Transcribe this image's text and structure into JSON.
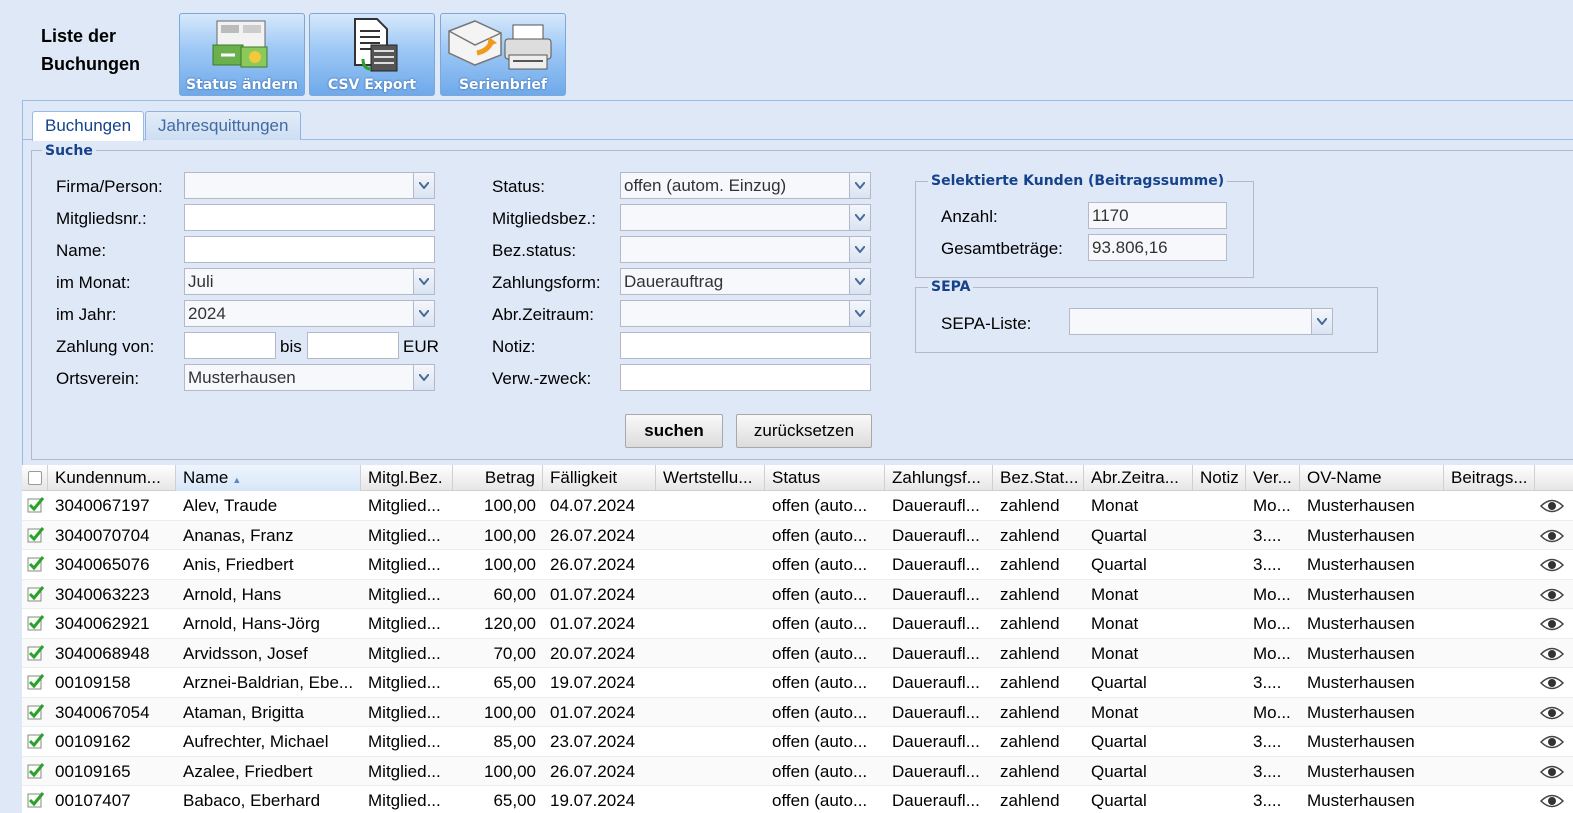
{
  "page": {
    "title": "Liste der Buchungen"
  },
  "toolbar": {
    "status_label": "Status ändern",
    "csv_label": "CSV Export",
    "serienbrief_label": "Serienbrief"
  },
  "tabs": [
    {
      "label": "Buchungen",
      "active": true
    },
    {
      "label": "Jahresquittungen",
      "active": false
    }
  ],
  "search": {
    "legend": "Suche",
    "left": {
      "firma_label": "Firma/Person:",
      "firma_value": "",
      "mitgliedsnr_label": "Mitgliedsnr.:",
      "mitgliedsnr_value": "",
      "name_label": "Name:",
      "name_value": "",
      "monat_label": "im Monat:",
      "monat_value": "Juli",
      "jahr_label": "im Jahr:",
      "jahr_value": "2024",
      "zahlung_label": "Zahlung von:",
      "zahlung_von": "",
      "bis_label": "bis",
      "zahlung_bis": "",
      "eur_label": "EUR",
      "ortsverein_label": "Ortsverein:",
      "ortsverein_value": "Musterhausen"
    },
    "middle": {
      "status_label": "Status:",
      "status_value": "offen (autom. Einzug)",
      "mitgliedsbez_label": "Mitgliedsbez.:",
      "mitgliedsbez_value": "",
      "bezstatus_label": "Bez.status:",
      "bezstatus_value": "",
      "zahlungsform_label": "Zahlungsform:",
      "zahlungsform_value": "Dauerauftrag",
      "abrzeitraum_label": "Abr.Zeitraum:",
      "abrzeitraum_value": "",
      "notiz_label": "Notiz:",
      "notiz_value": "",
      "verwzweck_label": "Verw.-zweck:",
      "verwzweck_value": ""
    },
    "selected": {
      "legend": "Selektierte Kunden (Beitragssumme)",
      "anzahl_label": "Anzahl:",
      "anzahl_value": "1170",
      "gesamt_label": "Gesamtbeträge:",
      "gesamt_value": "93.806,16"
    },
    "sepa": {
      "legend": "SEPA",
      "liste_label": "SEPA-Liste:",
      "liste_value": ""
    },
    "suchen_label": "suchen",
    "reset_label": "zurücksetzen"
  },
  "grid": {
    "columns": [
      "Kundennum...",
      "Name",
      "Mitgl.Bez.",
      "Betrag",
      "Fälligkeit",
      "Wertstellu...",
      "Status",
      "Zahlungsf...",
      "Bez.Stat...",
      "Abr.Zeitra...",
      "Notiz",
      "Ver...",
      "OV-Name",
      "Beitrags..."
    ],
    "rows": [
      [
        "3040067197",
        "Alev, Traude",
        "Mitglied...",
        "100,00",
        "04.07.2024",
        "",
        "offen (auto...",
        "Daueraufl...",
        "zahlend",
        "Monat",
        "",
        "Mo...",
        "Musterhausen",
        ""
      ],
      [
        "3040070704",
        "Ananas, Franz",
        "Mitglied...",
        "100,00",
        "26.07.2024",
        "",
        "offen (auto...",
        "Daueraufl...",
        "zahlend",
        "Quartal",
        "",
        "3....",
        "Musterhausen",
        ""
      ],
      [
        "3040065076",
        "Anis, Friedbert",
        "Mitglied...",
        "100,00",
        "26.07.2024",
        "",
        "offen (auto...",
        "Daueraufl...",
        "zahlend",
        "Quartal",
        "",
        "3....",
        "Musterhausen",
        ""
      ],
      [
        "3040063223",
        "Arnold, Hans",
        "Mitglied...",
        "60,00",
        "01.07.2024",
        "",
        "offen (auto...",
        "Daueraufl...",
        "zahlend",
        "Monat",
        "",
        "Mo...",
        "Musterhausen",
        ""
      ],
      [
        "3040062921",
        "Arnold, Hans-Jörg",
        "Mitglied...",
        "120,00",
        "01.07.2024",
        "",
        "offen (auto...",
        "Daueraufl...",
        "zahlend",
        "Monat",
        "",
        "Mo...",
        "Musterhausen",
        ""
      ],
      [
        "3040068948",
        "Arvidsson, Josef",
        "Mitglied...",
        "70,00",
        "20.07.2024",
        "",
        "offen (auto...",
        "Daueraufl...",
        "zahlend",
        "Monat",
        "",
        "Mo...",
        "Musterhausen",
        ""
      ],
      [
        "00109158",
        "Arznei-Baldrian, Ebe...",
        "Mitglied...",
        "65,00",
        "19.07.2024",
        "",
        "offen (auto...",
        "Daueraufl...",
        "zahlend",
        "Quartal",
        "",
        "3....",
        "Musterhausen",
        ""
      ],
      [
        "3040067054",
        "Ataman, Brigitta",
        "Mitglied...",
        "100,00",
        "01.07.2024",
        "",
        "offen (auto...",
        "Daueraufl...",
        "zahlend",
        "Monat",
        "",
        "Mo...",
        "Musterhausen",
        ""
      ],
      [
        "00109162",
        "Aufrechter, Michael",
        "Mitglied...",
        "85,00",
        "23.07.2024",
        "",
        "offen (auto...",
        "Daueraufl...",
        "zahlend",
        "Quartal",
        "",
        "3....",
        "Musterhausen",
        ""
      ],
      [
        "00109165",
        "Azalee, Friedbert",
        "Mitglied...",
        "100,00",
        "26.07.2024",
        "",
        "offen (auto...",
        "Daueraufl...",
        "zahlend",
        "Quartal",
        "",
        "3....",
        "Musterhausen",
        ""
      ],
      [
        "00107407",
        "Babaco, Eberhard",
        "Mitglied...",
        "65,00",
        "19.07.2024",
        "",
        "offen (auto...",
        "Daueraufl...",
        "zahlend",
        "Quartal",
        "",
        "3....",
        "Musterhausen",
        ""
      ]
    ]
  },
  "icons": {
    "status": "status-change-icon",
    "csv": "csv-export-icon",
    "serienbrief": "serienbrief-icon",
    "row_check": "checkmark-icon",
    "row_view": "eye-icon"
  },
  "colors": {
    "accent": "#15428b",
    "panel": "#dfe8f6",
    "check": "#2e9e2e"
  }
}
